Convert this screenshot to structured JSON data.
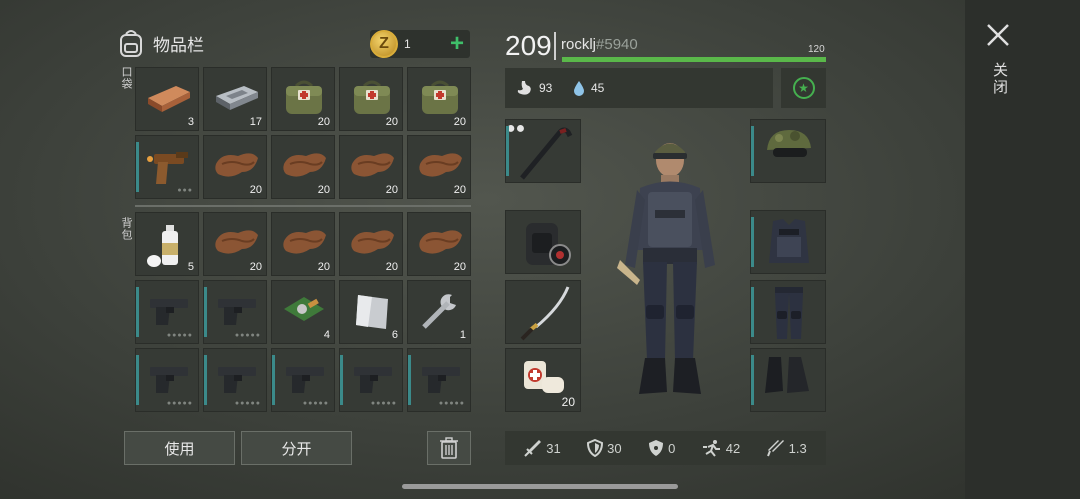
{
  "inventory": {
    "title": "物品栏",
    "coins": "1",
    "plus": "+",
    "pocket_label": "口袋",
    "backpack_label": "背包",
    "pocket_slots": [
      {
        "icon": "copper-ingot-icon",
        "qty": "3"
      },
      {
        "icon": "iron-ingot-icon",
        "qty": "17"
      },
      {
        "icon": "medical-bag-icon",
        "qty": "20"
      },
      {
        "icon": "medical-bag-icon",
        "qty": "20"
      },
      {
        "icon": "medical-bag-icon",
        "qty": "20"
      },
      {
        "icon": "flare-gun-icon",
        "qty": "",
        "dots": "●●●"
      },
      {
        "icon": "leather-icon",
        "qty": "20"
      },
      {
        "icon": "leather-icon",
        "qty": "20"
      },
      {
        "icon": "leather-icon",
        "qty": "20"
      },
      {
        "icon": "leather-icon",
        "qty": "20"
      }
    ],
    "backpack_slots": [
      {
        "icon": "spray-can-icon",
        "qty": "5"
      },
      {
        "icon": "leather-icon",
        "qty": "20"
      },
      {
        "icon": "leather-icon",
        "qty": "20"
      },
      {
        "icon": "leather-icon",
        "qty": "20"
      },
      {
        "icon": "leather-icon",
        "qty": "20"
      },
      {
        "icon": "pistol-icon",
        "qty": "",
        "dots": "●●●●●"
      },
      {
        "icon": "pistol-icon",
        "qty": "",
        "dots": "●●●●●"
      },
      {
        "icon": "circuit-board-icon",
        "qty": "4"
      },
      {
        "icon": "metal-sheet-icon",
        "qty": "6"
      },
      {
        "icon": "wrench-icon",
        "qty": "1"
      },
      {
        "icon": "pistol-icon",
        "qty": "",
        "dots": "●●●●●"
      },
      {
        "icon": "pistol-icon",
        "qty": "",
        "dots": "●●●●●"
      },
      {
        "icon": "pistol-icon",
        "qty": "",
        "dots": "●●●●●"
      },
      {
        "icon": "pistol-icon",
        "qty": "",
        "dots": "●●●●●"
      },
      {
        "icon": "pistol-icon",
        "qty": "",
        "dots": "●●●●●"
      }
    ],
    "use_label": "使用",
    "split_label": "分开"
  },
  "character": {
    "level": "209",
    "name": "rocklj",
    "tag": "#5940",
    "xp_max": "120",
    "xp_progress": 1.0,
    "food": "93",
    "water": "45",
    "weapon_slots": [
      {
        "icon": "crowbar-icon",
        "qty": "",
        "dots": "●●"
      },
      {
        "icon": "backpack-icon",
        "qty": ""
      },
      {
        "icon": "katana-icon",
        "qty": ""
      },
      {
        "icon": "bandage-icon",
        "qty": "20"
      }
    ],
    "armor_slots": [
      {
        "icon": "camo-cap-icon"
      },
      {
        "icon": "police-vest-icon"
      },
      {
        "icon": "police-pants-icon"
      },
      {
        "icon": "boots-icon"
      }
    ],
    "stats": {
      "attack": "31",
      "defense": "30",
      "radiation": "0",
      "speed": "42",
      "damage_mult": "1.3"
    }
  },
  "close_label": "关闭",
  "colors": {
    "accent_green": "#5ab84a",
    "slot_bar": "#3b8a8a"
  }
}
